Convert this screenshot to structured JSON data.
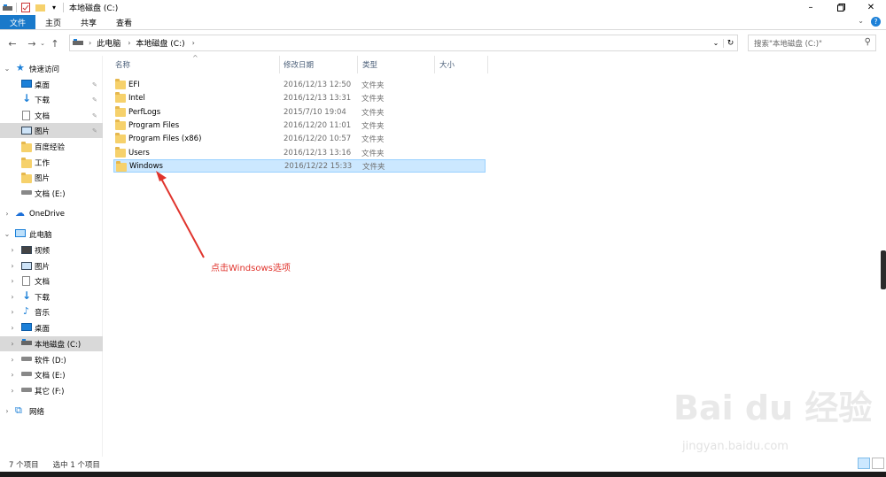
{
  "window": {
    "title": "本地磁盘 (C:)",
    "minimize_icon": "minimize-icon",
    "maximize_icon": "maximize-icon",
    "close_icon": "close-icon"
  },
  "ribbon": {
    "tabs": [
      {
        "label": "文件"
      },
      {
        "label": "主页"
      },
      {
        "label": "共享"
      },
      {
        "label": "查看"
      }
    ]
  },
  "address": {
    "crumbs": [
      "此电脑",
      "本地磁盘 (C:)"
    ],
    "search_placeholder": "搜索\"本地磁盘 (C:)\""
  },
  "nav": {
    "quick_access": "快速访问",
    "quick_items": [
      {
        "label": "桌面",
        "icon": "desktop-icon",
        "pinned": true
      },
      {
        "label": "下载",
        "icon": "download-icon",
        "pinned": true
      },
      {
        "label": "文档",
        "icon": "document-icon",
        "pinned": true
      },
      {
        "label": "图片",
        "icon": "pictures-icon",
        "pinned": true
      },
      {
        "label": "百度经验",
        "icon": "folder-icon"
      },
      {
        "label": "工作",
        "icon": "folder-icon"
      },
      {
        "label": "图片",
        "icon": "folder-icon"
      },
      {
        "label": "文档 (E:)",
        "icon": "drive-icon"
      }
    ],
    "onedrive": "OneDrive",
    "this_pc": "此电脑",
    "pc_items": [
      {
        "label": "视频",
        "icon": "video-icon"
      },
      {
        "label": "图片",
        "icon": "pictures-icon"
      },
      {
        "label": "文档",
        "icon": "document-icon"
      },
      {
        "label": "下载",
        "icon": "download-icon"
      },
      {
        "label": "音乐",
        "icon": "music-icon"
      },
      {
        "label": "桌面",
        "icon": "desktop-icon"
      },
      {
        "label": "本地磁盘 (C:)",
        "icon": "drive-icon",
        "selected": true
      },
      {
        "label": "软件 (D:)",
        "icon": "drive-icon"
      },
      {
        "label": "文档 (E:)",
        "icon": "drive-icon"
      },
      {
        "label": "其它 (F:)",
        "icon": "drive-icon"
      }
    ],
    "network": "网络"
  },
  "columns": [
    "名称",
    "修改日期",
    "类型",
    "大小"
  ],
  "files": [
    {
      "name": "EFI",
      "date": "2016/12/13 12:50",
      "type": "文件夹"
    },
    {
      "name": "Intel",
      "date": "2016/12/13 13:31",
      "type": "文件夹"
    },
    {
      "name": "PerfLogs",
      "date": "2015/7/10 19:04",
      "type": "文件夹"
    },
    {
      "name": "Program Files",
      "date": "2016/12/20 11:01",
      "type": "文件夹"
    },
    {
      "name": "Program Files (x86)",
      "date": "2016/12/20 10:57",
      "type": "文件夹"
    },
    {
      "name": "Users",
      "date": "2016/12/13 13:16",
      "type": "文件夹"
    },
    {
      "name": "Windows",
      "date": "2016/12/22 15:33",
      "type": "文件夹",
      "selected": true
    }
  ],
  "annotation": "点击Windsows选项",
  "status": {
    "count": "7 个项目",
    "selected": "选中 1 个项目"
  },
  "watermark": {
    "logo": "Bai du 经验",
    "url": "jingyan.baidu.com"
  },
  "colors": {
    "accent": "#1979ca",
    "selection": "#cce8ff",
    "annotation": "#e0342d"
  }
}
